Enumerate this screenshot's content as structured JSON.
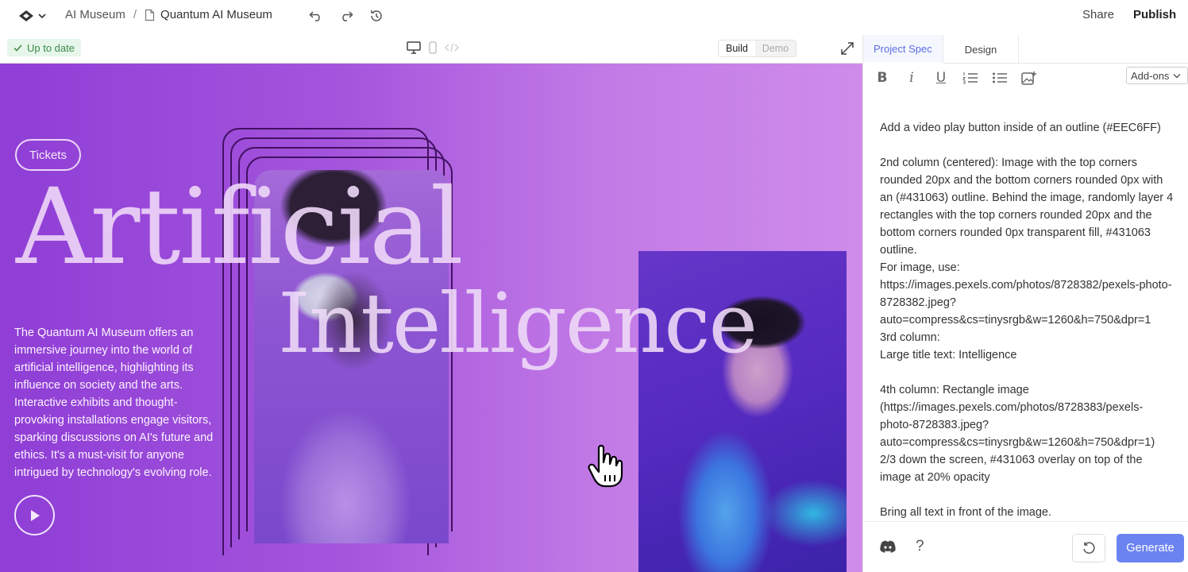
{
  "topbar": {
    "logo_icon": "app-logo-icon",
    "breadcrumb_root": "AI Museum",
    "breadcrumb_separator": "/",
    "breadcrumb_current": "Quantum AI Museum",
    "share_label": "Share",
    "publish_label": "Publish"
  },
  "subbar": {
    "status_label": "Up to date",
    "mode_build": "Build",
    "mode_demo": "Demo"
  },
  "canvas": {
    "tickets_label": "Tickets",
    "title_line1": "Artificial",
    "title_line2": "Intelligence",
    "description": "The Quantum AI Museum offers an immersive journey into the world of artificial intelligence, highlighting its influence on society and the arts. Interactive exhibits and thought-provoking installations engage visitors, sparking discussions on AI's future and ethics. It's a must-visit for anyone intrigued by technology's evolving role.",
    "colors": {
      "gradient_start": "#8f3ed6",
      "gradient_end": "#cf8cea",
      "outline": "#431063"
    }
  },
  "panel": {
    "tab_spec": "Project Spec",
    "tab_design": "Design",
    "addons_label": "Add-ons",
    "spec_text": "Add a video play button inside of an outline (#EEC6FF)\n\n2nd column (centered): Image with the top corners rounded 20px and the bottom corners rounded 0px with an (#431063) outline. Behind the image, randomly layer 4 rectangles with the top corners rounded 20px and the bottom corners rounded 0px transparent fill, #431063 outline.\nFor image, use:\nhttps://images.pexels.com/photos/8728382/pexels-photo-8728382.jpeg?auto=compress&cs=tinysrgb&w=1260&h=750&dpr=1\n3rd column:\nLarge title text: Intelligence\n\n4th column: Rectangle image (https://images.pexels.com/photos/8728383/pexels-photo-8728383.jpeg?auto=compress&cs=tinysrgb&w=1260&h=750&dpr=1) 2/3 down the screen, #431063 overlay on top of the image at 20% opacity\n\nBring all text in front of the image.\nError: make sure second image shows\nError: make sure there is no line break in \"Artificial\"",
    "help_label": "?",
    "generate_label": "Generate",
    "accent_color": "#6b83f0"
  }
}
